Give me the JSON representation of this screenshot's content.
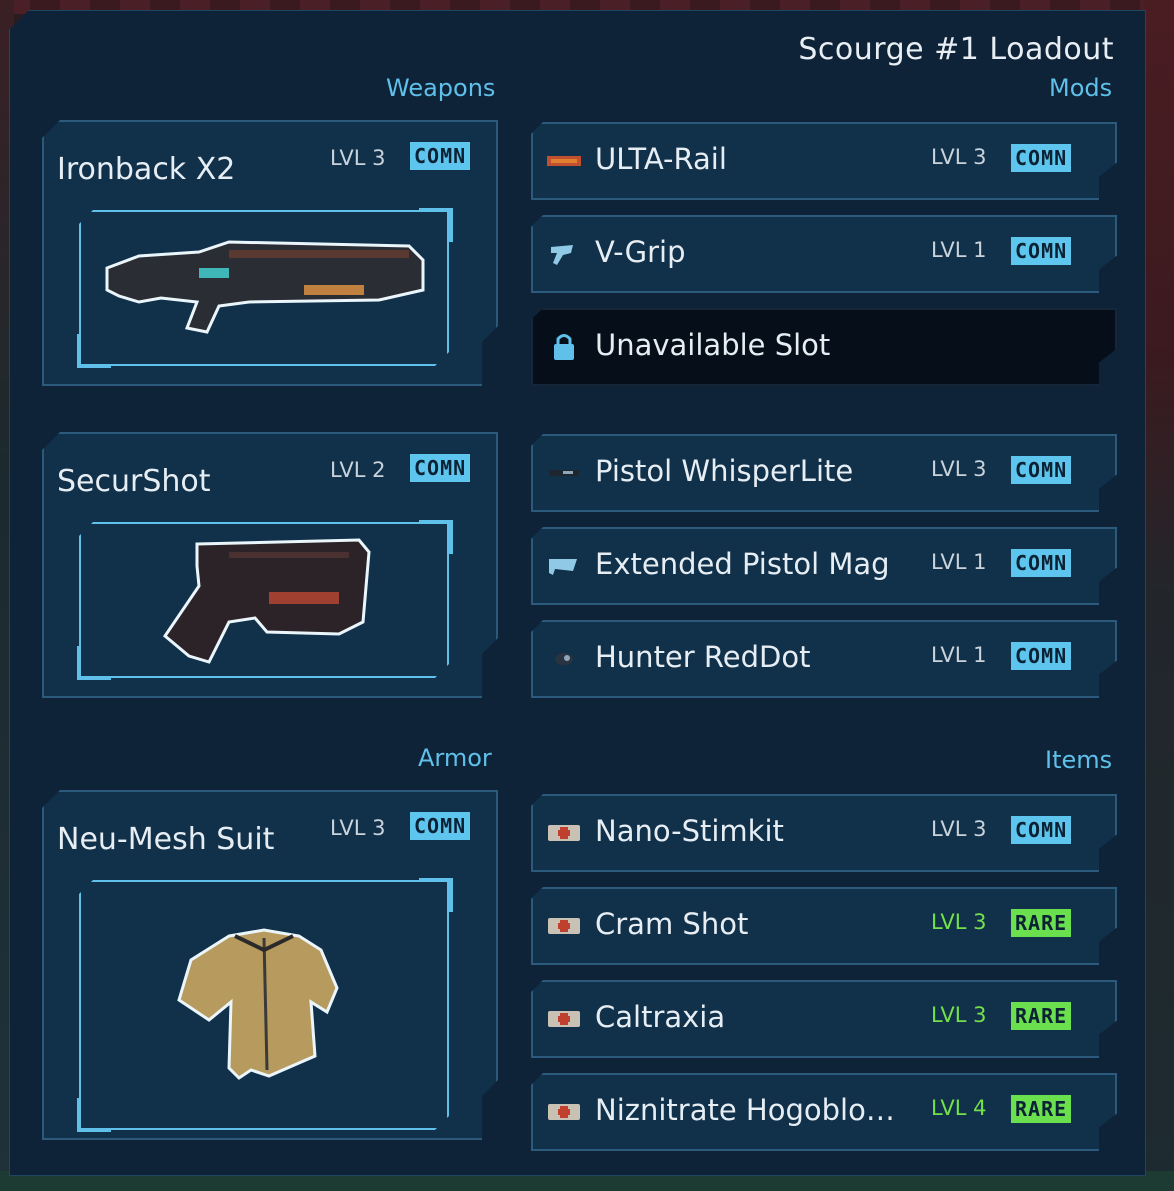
{
  "loadout": {
    "title": "Scourge #1 Loadout"
  },
  "sections": {
    "weapons": "Weapons",
    "mods": "Mods",
    "armor": "Armor",
    "items": "Items"
  },
  "weapons": [
    {
      "name": "Ironback X2",
      "level": "LVL 3",
      "rarity": "COMN",
      "icon": "shotgun-icon"
    },
    {
      "name": "SecurShot",
      "level": "LVL 2",
      "rarity": "COMN",
      "icon": "pistol-icon"
    }
  ],
  "armor": {
    "name": "Neu-Mesh Suit",
    "level": "LVL 3",
    "rarity": "COMN",
    "icon": "armor-vest-icon"
  },
  "mods": [
    {
      "name": "ULTA-Rail",
      "level": "LVL 3",
      "rarity": "COMN",
      "icon": "rail-mod-icon"
    },
    {
      "name": "V-Grip",
      "level": "LVL 1",
      "rarity": "COMN",
      "icon": "grip-mod-icon"
    },
    {
      "name": "Unavailable Slot",
      "icon": "lock-icon"
    },
    {
      "name": "Pistol WhisperLite",
      "level": "LVL 3",
      "rarity": "COMN",
      "icon": "silencer-mod-icon"
    },
    {
      "name": "Extended Pistol Mag",
      "level": "LVL 1",
      "rarity": "COMN",
      "icon": "magazine-mod-icon"
    },
    {
      "name": "Hunter RedDot",
      "level": "LVL 1",
      "rarity": "COMN",
      "icon": "sight-mod-icon"
    }
  ],
  "items": [
    {
      "name": "Nano-Stimkit",
      "level": "LVL 3",
      "rarity": "COMN",
      "icon": "medkit-icon"
    },
    {
      "name": "Cram Shot",
      "level": "LVL 3",
      "rarity": "RARE",
      "icon": "medkit-icon"
    },
    {
      "name": "Caltraxia",
      "level": "LVL 3",
      "rarity": "RARE",
      "icon": "medkit-icon"
    },
    {
      "name": "Niznitrate Hogoblo…",
      "level": "LVL 4",
      "rarity": "RARE",
      "icon": "medkit-icon"
    }
  ],
  "colors": {
    "common": "#5ec6ee",
    "rare": "#6ae04e",
    "accent": "#5fc0ea",
    "panel": "#0e2337"
  }
}
